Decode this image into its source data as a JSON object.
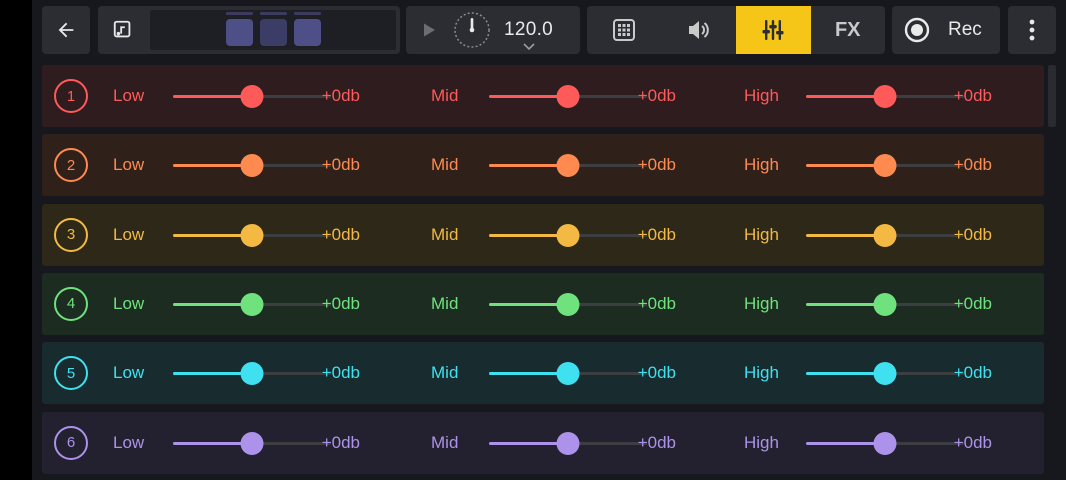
{
  "toolbar": {
    "tempo_value": "120.0",
    "rec_label": "Rec",
    "fx_label": "FX",
    "active_view": "mixer"
  },
  "channels": [
    {
      "number": "1",
      "color": "#ff5a5a",
      "bg": "#2e1c1e",
      "bands": [
        {
          "label": "Low",
          "db": "+0db",
          "level": 0.5
        },
        {
          "label": "Mid",
          "db": "+0db",
          "level": 0.5
        },
        {
          "label": "High",
          "db": "+0db",
          "level": 0.5
        }
      ]
    },
    {
      "number": "2",
      "color": "#ff8a50",
      "bg": "#2f2119",
      "bands": [
        {
          "label": "Low",
          "db": "+0db",
          "level": 0.5
        },
        {
          "label": "Mid",
          "db": "+0db",
          "level": 0.5
        },
        {
          "label": "High",
          "db": "+0db",
          "level": 0.5
        }
      ]
    },
    {
      "number": "3",
      "color": "#f3b942",
      "bg": "#2e2818",
      "bands": [
        {
          "label": "Low",
          "db": "+0db",
          "level": 0.5
        },
        {
          "label": "Mid",
          "db": "+0db",
          "level": 0.5
        },
        {
          "label": "High",
          "db": "+0db",
          "level": 0.5
        }
      ]
    },
    {
      "number": "4",
      "color": "#6fe27d",
      "bg": "#1d2c21",
      "bands": [
        {
          "label": "Low",
          "db": "+0db",
          "level": 0.5
        },
        {
          "label": "Mid",
          "db": "+0db",
          "level": 0.5
        },
        {
          "label": "High",
          "db": "+0db",
          "level": 0.5
        }
      ]
    },
    {
      "number": "5",
      "color": "#3fe0ef",
      "bg": "#182c30",
      "bands": [
        {
          "label": "Low",
          "db": "+0db",
          "level": 0.5
        },
        {
          "label": "Mid",
          "db": "+0db",
          "level": 0.5
        },
        {
          "label": "High",
          "db": "+0db",
          "level": 0.5
        }
      ]
    },
    {
      "number": "6",
      "color": "#ac92ea",
      "bg": "#23212f",
      "bands": [
        {
          "label": "Low",
          "db": "+0db",
          "level": 0.5
        },
        {
          "label": "Mid",
          "db": "+0db",
          "level": 0.5
        },
        {
          "label": "High",
          "db": "+0db",
          "level": 0.5
        }
      ]
    }
  ],
  "icons": {
    "back": "arrow-left-icon",
    "pattern": "music-note-icon",
    "play": "play-icon",
    "tempo": "metronome-dial-icon",
    "pads": "grid-pads-icon",
    "volume": "speaker-icon",
    "mixer": "sliders-icon",
    "record": "record-icon",
    "more": "more-vertical-icon"
  }
}
